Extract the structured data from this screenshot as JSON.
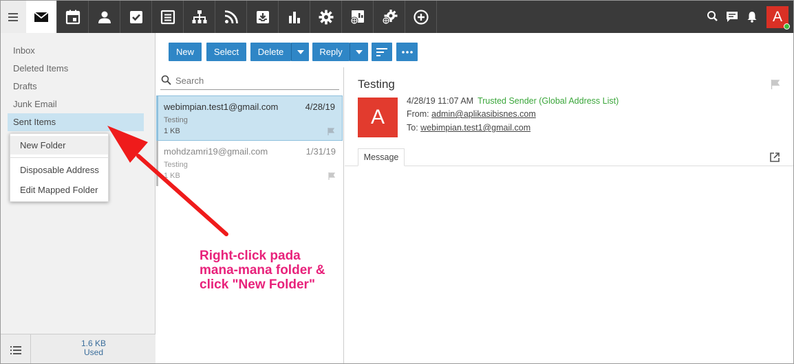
{
  "topbar": {
    "apps": [
      {
        "name": "mail-app-icon",
        "icon": "envelope"
      },
      {
        "name": "calendar-app-icon",
        "icon": "calendar"
      },
      {
        "name": "contacts-app-icon",
        "icon": "person"
      },
      {
        "name": "tasks-app-icon",
        "icon": "checkbox"
      },
      {
        "name": "notes-app-icon",
        "icon": "notes"
      },
      {
        "name": "org-chart-app-icon",
        "icon": "sitemap"
      },
      {
        "name": "rss-app-icon",
        "icon": "rss"
      },
      {
        "name": "download-app-icon",
        "icon": "inbox-download"
      },
      {
        "name": "reports-app-icon",
        "icon": "bar-chart"
      },
      {
        "name": "settings-app-icon",
        "icon": "gear"
      },
      {
        "name": "domain-reports-app-icon",
        "icon": "chart-globe"
      },
      {
        "name": "domain-settings-app-icon",
        "icon": "gear-globe"
      },
      {
        "name": "add-app-icon",
        "icon": "plus-circle"
      }
    ],
    "avatar_letter": "A",
    "accent_color": "#d93025"
  },
  "sidebar": {
    "folders": [
      {
        "label": "Inbox"
      },
      {
        "label": "Deleted Items"
      },
      {
        "label": "Drafts"
      },
      {
        "label": "Junk Email"
      },
      {
        "label": "Sent Items"
      }
    ],
    "usage_size": "1.6 KB",
    "usage_label": "Used"
  },
  "context_menu": {
    "items": [
      {
        "label": "New Folder"
      },
      {
        "label": "Disposable Address"
      },
      {
        "label": "Edit Mapped Folder"
      }
    ]
  },
  "toolbar": {
    "new_label": "New",
    "select_label": "Select",
    "delete_label": "Delete",
    "reply_label": "Reply",
    "button_color": "#2f86c6"
  },
  "message_list": {
    "search_placeholder": "Search",
    "messages": [
      {
        "from": "webimpian.test1@gmail.com",
        "date": "4/28/19",
        "subject": "Testing",
        "size": "1 KB"
      },
      {
        "from": "mohdzamri19@gmail.com",
        "date": "1/31/19",
        "subject": "Testing",
        "size": "1 KB"
      }
    ]
  },
  "reader": {
    "subject": "Testing",
    "avatar_letter": "A",
    "datetime": "4/28/19 11:07 AM",
    "trusted": "Trusted Sender (Global Address List)",
    "from_label": "From:",
    "from_address": "admin@aplikasibisnes.com",
    "to_label": "To:",
    "to_address": "webimpian.test1@gmail.com",
    "tab_label": "Message"
  },
  "annotation": {
    "line1": "Right-click pada",
    "line2": "mana-mana folder &",
    "line3": "click \"New Folder\"",
    "color": "#e8227b"
  }
}
